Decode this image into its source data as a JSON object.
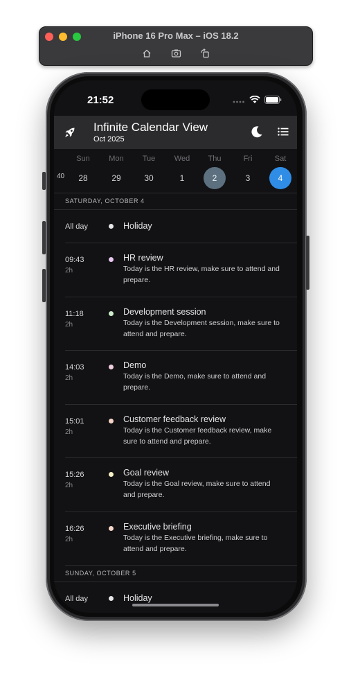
{
  "simulator": {
    "title": "iPhone 16 Pro Max – iOS 18.2",
    "tools": [
      "home-icon",
      "screenshot-icon",
      "rotate-icon"
    ]
  },
  "status_bar": {
    "time": "21:52",
    "icons": [
      "signal-icon",
      "wifi-icon",
      "battery-icon"
    ]
  },
  "app_bar": {
    "title": "Infinite Calendar View",
    "subtitle": "Oct 2025",
    "icons": [
      "rocket-icon",
      "moon-icon",
      "list-icon"
    ]
  },
  "week_strip": {
    "week_number": "40",
    "days": [
      {
        "name": "Sun",
        "date": "28",
        "state": "normal"
      },
      {
        "name": "Mon",
        "date": "29",
        "state": "normal"
      },
      {
        "name": "Tue",
        "date": "30",
        "state": "normal"
      },
      {
        "name": "Wed",
        "date": "1",
        "state": "normal"
      },
      {
        "name": "Thu",
        "date": "2",
        "state": "today"
      },
      {
        "name": "Fri",
        "date": "3",
        "state": "normal"
      },
      {
        "name": "Sat",
        "date": "4",
        "state": "selected"
      }
    ]
  },
  "agenda": {
    "sections": [
      {
        "label": "SATURDAY, OCTOBER 4",
        "events": [
          {
            "time": "All day",
            "duration": "",
            "title": "Holiday",
            "description": "",
            "dot_color": "#e6e6e8"
          },
          {
            "time": "09:43",
            "duration": "2h",
            "title": "HR review",
            "description": "Today is the HR review, make sure to attend and prepare.",
            "dot_color": "#e8c7f0"
          },
          {
            "time": "11:18",
            "duration": "2h",
            "title": "Development session",
            "description": "Today is the Development session, make sure to attend and prepare.",
            "dot_color": "#cdeccb"
          },
          {
            "time": "14:03",
            "duration": "2h",
            "title": "Demo",
            "description": "Today is the Demo, make sure to attend and prepare.",
            "dot_color": "#f2cfe0"
          },
          {
            "time": "15:01",
            "duration": "2h",
            "title": "Customer feedback review",
            "description": "Today is the Customer feedback review, make sure to attend and prepare.",
            "dot_color": "#f6d4c8"
          },
          {
            "time": "15:26",
            "duration": "2h",
            "title": "Goal review",
            "description": "Today is the Goal review, make sure to attend and prepare.",
            "dot_color": "#f7efc6"
          },
          {
            "time": "16:26",
            "duration": "2h",
            "title": "Executive briefing",
            "description": "Today is the Executive briefing, make sure to attend and prepare.",
            "dot_color": "#f6d7c9"
          }
        ]
      },
      {
        "label": "SUNDAY, OCTOBER 5",
        "events": [
          {
            "time": "All day",
            "duration": "",
            "title": "Holiday",
            "description": "",
            "dot_color": "#e6e6e8"
          }
        ]
      }
    ]
  }
}
